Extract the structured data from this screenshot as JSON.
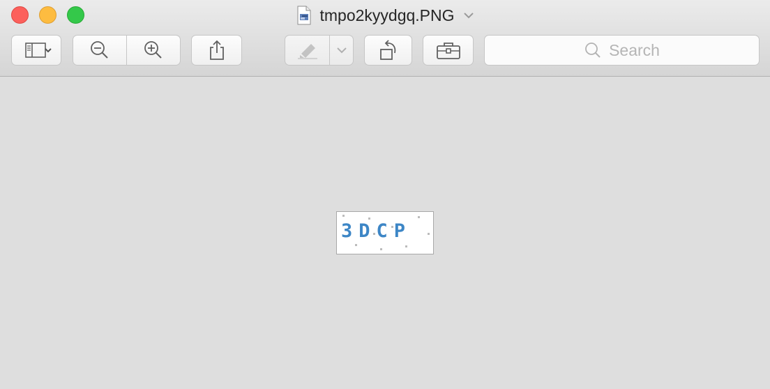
{
  "window": {
    "title": "tmpo2kyydgq.PNG"
  },
  "toolbar": {
    "buttons": [
      {
        "name": "sidebar-toggle",
        "icon": "sidebar-icon"
      },
      {
        "name": "zoom-out",
        "icon": "zoom-out-icon"
      },
      {
        "name": "zoom-in",
        "icon": "zoom-in-icon"
      },
      {
        "name": "share",
        "icon": "share-icon"
      },
      {
        "name": "markup",
        "icon": "highlighter-icon",
        "disabled": true
      },
      {
        "name": "rotate-left",
        "icon": "rotate-left-icon"
      },
      {
        "name": "markup-toolbox",
        "icon": "toolbox-icon"
      }
    ],
    "search": {
      "placeholder": "Search"
    }
  },
  "document": {
    "captcha_text": "3DCP",
    "text_color": "#3d86c6"
  },
  "colors": {
    "close": "#fc605c",
    "minimize": "#fdbc40",
    "maximize": "#34c84a",
    "background": "#dedede"
  }
}
